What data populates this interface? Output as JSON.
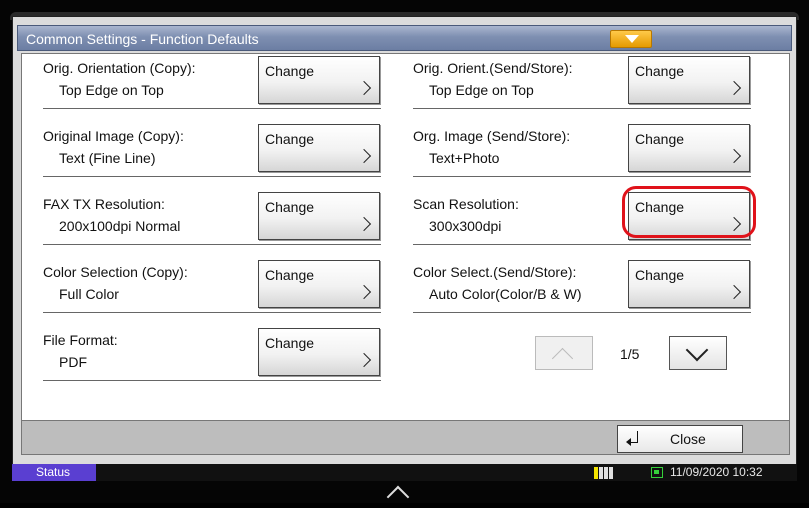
{
  "title": "Common Settings - Function Defaults",
  "items": [
    {
      "label": "Orig. Orientation (Copy):",
      "value": "Top Edge on Top",
      "button": "Change"
    },
    {
      "label": "Orig. Orient.(Send/Store):",
      "value": "Top Edge on Top",
      "button": "Change"
    },
    {
      "label": "Original Image (Copy):",
      "value": "Text (Fine Line)",
      "button": "Change"
    },
    {
      "label": "Org. Image (Send/Store):",
      "value": "Text+Photo",
      "button": "Change"
    },
    {
      "label": "FAX TX Resolution:",
      "value": "200x100dpi Normal",
      "button": "Change"
    },
    {
      "label": "Scan Resolution:",
      "value": "300x300dpi",
      "button": "Change",
      "highlighted": true
    },
    {
      "label": "Color Selection (Copy):",
      "value": "Full Color",
      "button": "Change"
    },
    {
      "label": "Color Select.(Send/Store):",
      "value": "Auto Color(Color/B & W)",
      "button": "Change"
    },
    {
      "label": "File Format:",
      "value": "PDF",
      "button": "Change"
    }
  ],
  "pager": {
    "text": "1/5"
  },
  "footer": {
    "close_label": "Close"
  },
  "statusbar": {
    "status_label": "Status",
    "datetime": "11/09/2020  10:32",
    "toner_colors": [
      "#f4e400",
      "#e0e0e0",
      "#e0e0e0",
      "#e0e0e0"
    ]
  },
  "colors": {
    "highlight": "#e0121a",
    "titlebar": "#7e8fb1",
    "status_tab": "#5a3fd1"
  },
  "icons": {
    "expand": "expand-tab-icon",
    "home": "home-icon",
    "network": "network-icon"
  }
}
